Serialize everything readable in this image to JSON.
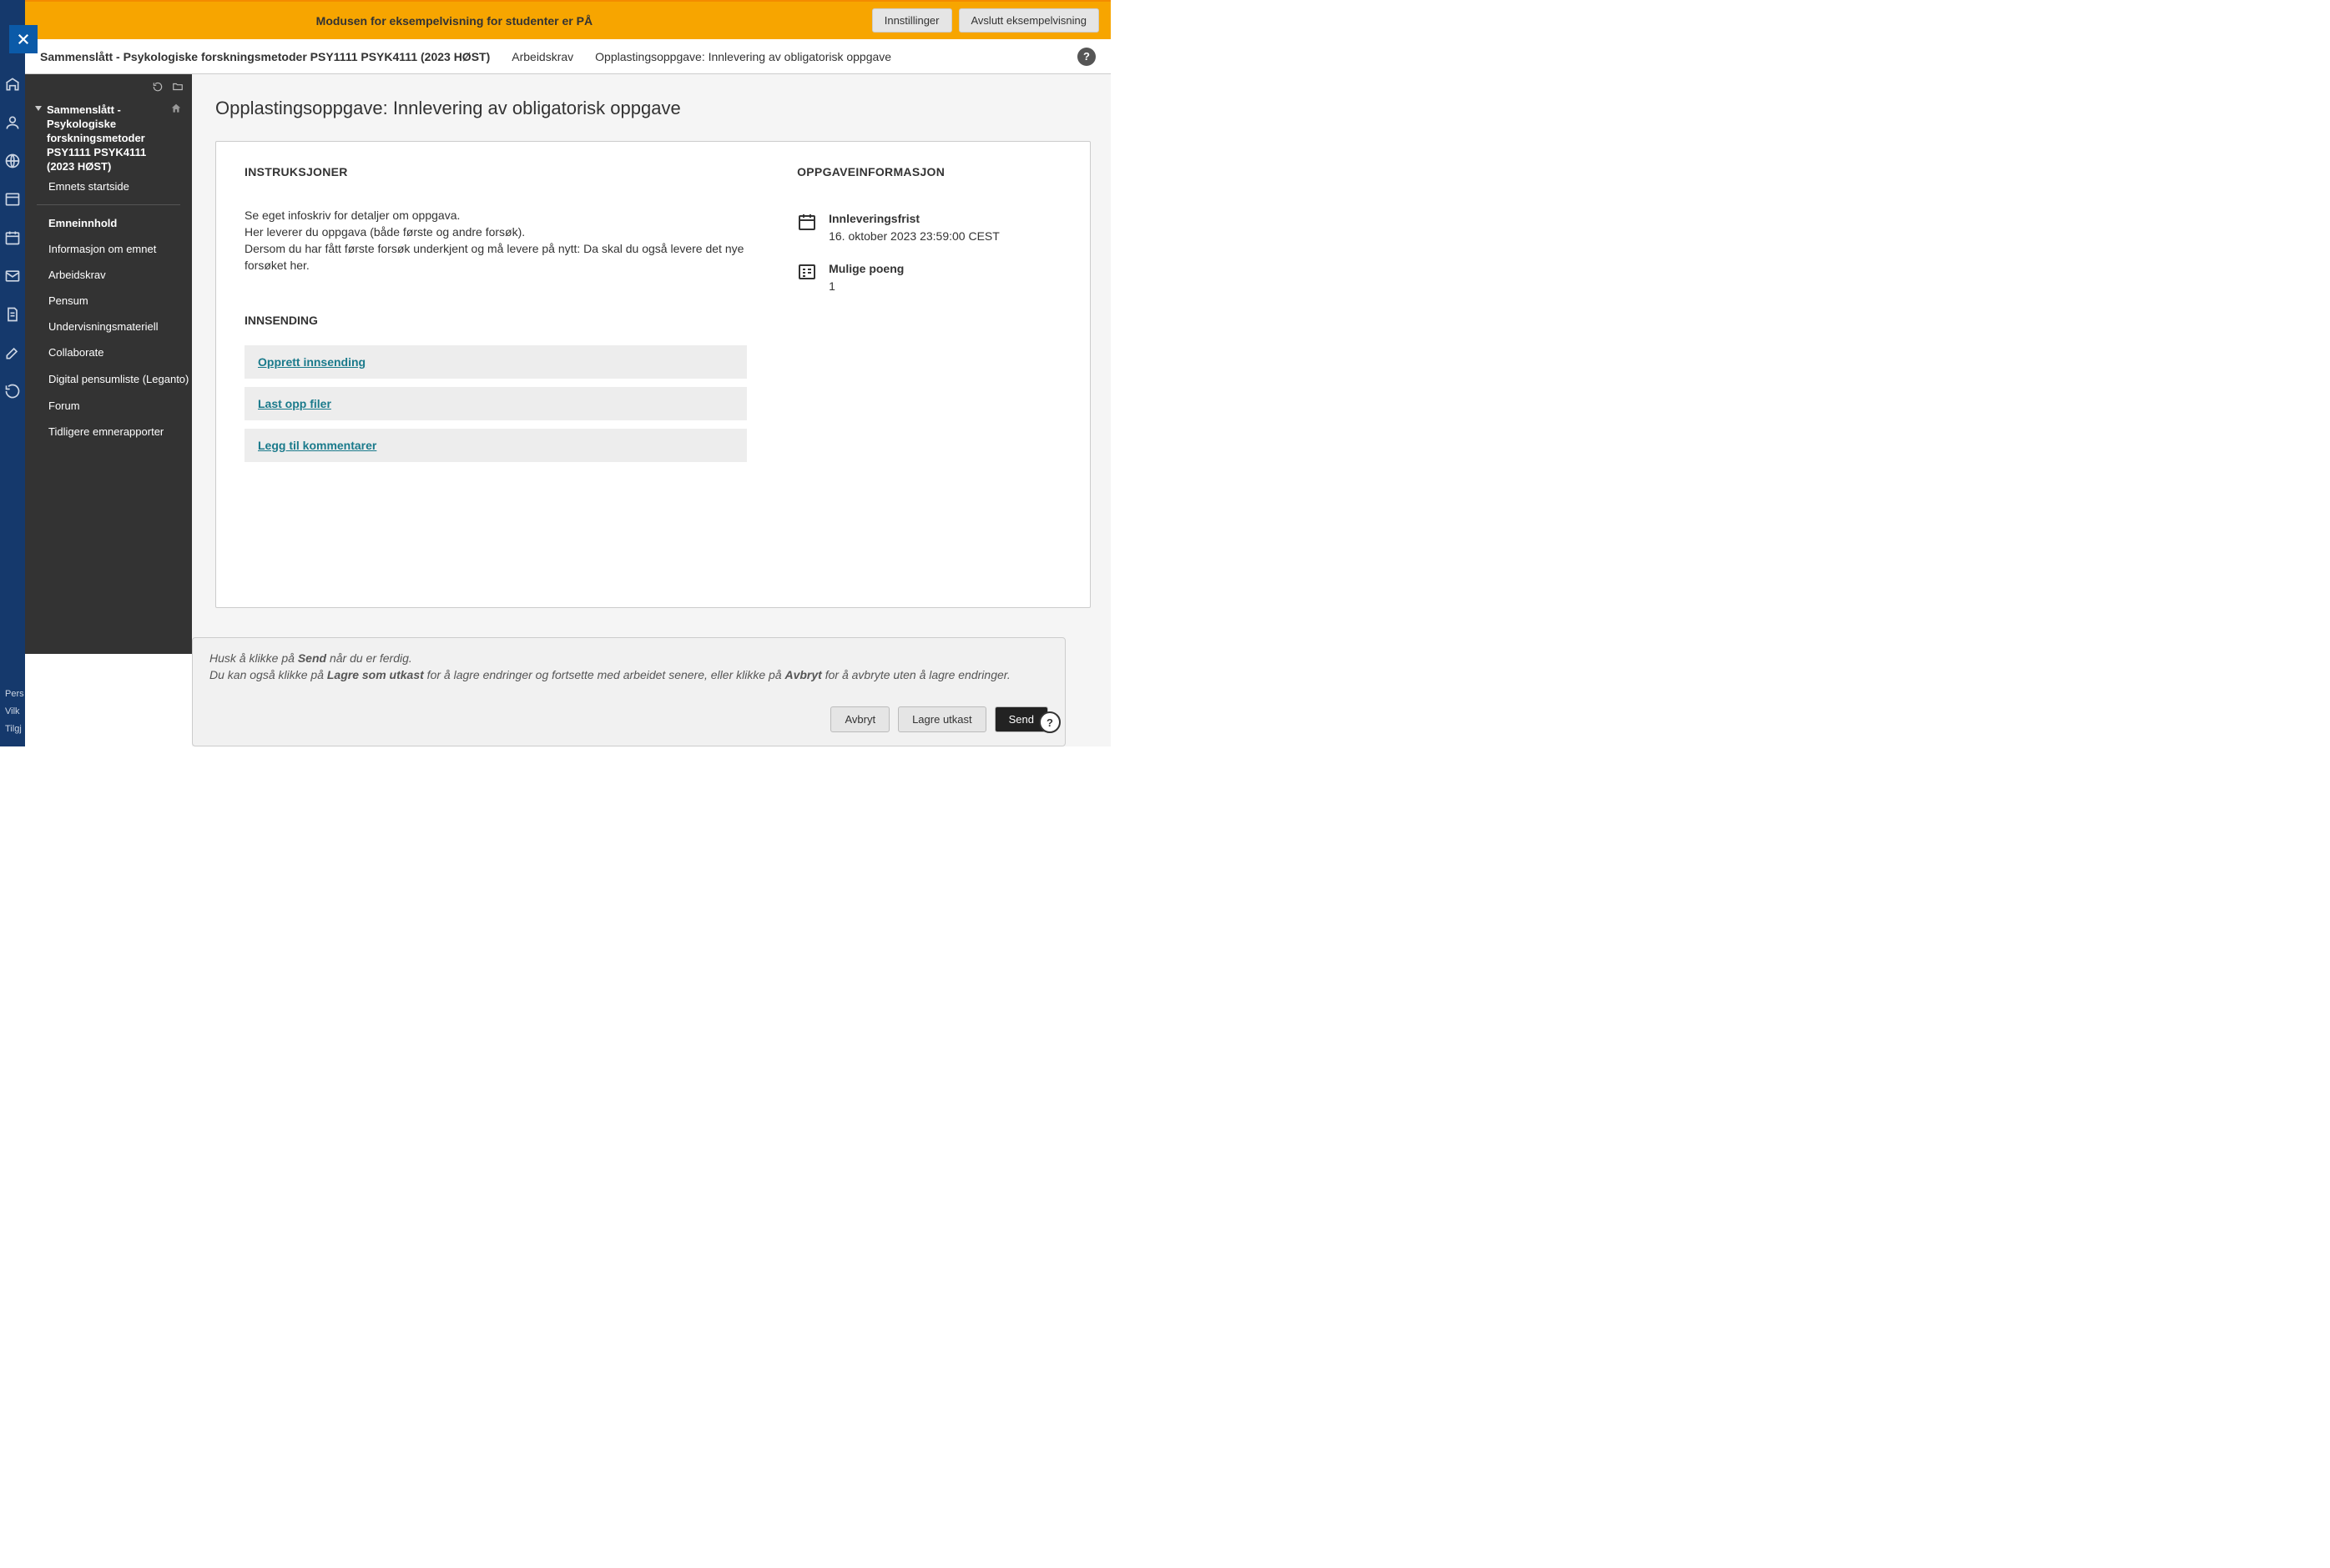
{
  "banner": {
    "text": "Modusen for eksempelvisning for studenter er PÅ",
    "settings": "Innstillinger",
    "end": "Avslutt eksempelvisning"
  },
  "breadcrumb": {
    "first": "Sammenslått - Psykologiske forskningsmetoder PSY1111 PSYK4111 (2023 HØST)",
    "second": "Arbeidskrav",
    "third": "Opplastingsoppgave: Innlevering av obligatorisk oppgave"
  },
  "sidebar": {
    "course_title": "Sammenslått - Psykologiske forskningsmetoder PSY1111 PSYK4111 (2023 HØST)",
    "home": "Emnets startside",
    "items": [
      "Emneinnhold",
      "Informasjon om emnet",
      "Arbeidskrav",
      "Pensum",
      "Undervisningsmateriell",
      "Collaborate",
      "Digital pensumliste (Leganto)",
      "Forum",
      "Tidligere emnerapporter"
    ]
  },
  "rail_footer": [
    "Pers",
    "Vilk",
    "Tilgj"
  ],
  "page": {
    "title": "Opplastingsoppgave: Innlevering av obligatorisk oppgave"
  },
  "instructions": {
    "head": "INSTRUKSJONER",
    "p1": "Se eget infoskriv for detaljer om oppgava.",
    "p2": "Her leverer du oppgava (både første og andre forsøk).",
    "p3": "Dersom du har fått første forsøk underkjent og må levere på nytt: Da skal du også levere det nye forsøket her."
  },
  "submission": {
    "head": "INNSENDING",
    "create": "Opprett innsending",
    "upload": "Last opp filer",
    "comment": "Legg til kommentarer"
  },
  "info": {
    "head": "OPPGAVEINFORMASJON",
    "due_label": "Innleveringsfrist",
    "due_value": "16. oktober 2023 23:59:00 CEST",
    "points_label": "Mulige poeng",
    "points_value": "1"
  },
  "footer": {
    "line1_a": "Husk å klikke på ",
    "line1_b": "Send",
    "line1_c": " når du er ferdig.",
    "line2_a": "Du kan også klikke på ",
    "line2_b": "Lagre som utkast",
    "line2_c": " for å lagre endringer og fortsette med arbeidet senere, eller klikke på ",
    "line2_d": "Avbryt",
    "line2_e": " for å avbryte uten å lagre endringer.",
    "cancel": "Avbryt",
    "draft": "Lagre utkast",
    "send": "Send"
  }
}
